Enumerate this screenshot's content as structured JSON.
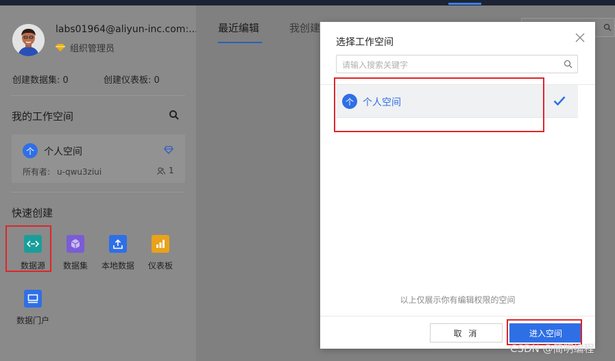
{
  "user": {
    "email": "labs01964@aliyun-inc.com:...",
    "role": "组织管理员"
  },
  "stats": {
    "datasets": "创建数据集: 0",
    "dashboards": "创建仪表板: 0"
  },
  "sidebar": {
    "my_workspaces_title": "我的工作空间",
    "workspace": {
      "icon_char": "个",
      "name": "个人空间",
      "owner_label": "所有者:",
      "owner_value": "u-qwu3ziui",
      "member_count": "1"
    },
    "quick_create_title": "快速创建",
    "quick_items": [
      {
        "label": "数据源",
        "icon": "datasource-icon",
        "color": "#1a9e9a"
      },
      {
        "label": "数据集",
        "icon": "dataset-cube-icon",
        "color": "#7b5cd6"
      },
      {
        "label": "本地数据",
        "icon": "upload-icon",
        "color": "#2f6fe6"
      },
      {
        "label": "仪表板",
        "icon": "bar-chart-icon",
        "color": "#e9a21a"
      },
      {
        "label": "数据门户",
        "icon": "portal-icon",
        "color": "#2f6fe6"
      }
    ]
  },
  "main": {
    "tabs": [
      "最近编辑",
      "我创建"
    ]
  },
  "modal": {
    "title": "选择工作空间",
    "search_placeholder": "请输入搜索关键字",
    "items": [
      {
        "icon_char": "个",
        "label": "个人空间",
        "selected": true
      }
    ],
    "note": "以上仅展示你有编辑权限的空间",
    "cancel_label": "取 消",
    "enter_label": "进入空间"
  },
  "watermark": "CSDN @简明编程",
  "colors": {
    "accent": "#2f6fe6",
    "highlight_border": "#e0242a",
    "overlay": "#808080"
  }
}
